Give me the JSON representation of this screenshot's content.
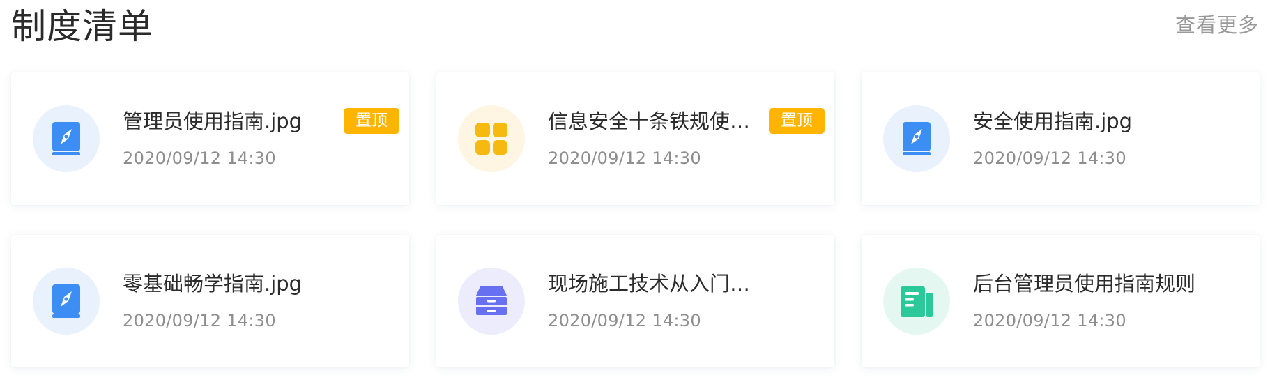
{
  "header": {
    "title": "制度清单",
    "view_more": "查看更多"
  },
  "colors": {
    "pin_badge": "#ffb400",
    "blue_icon": "#3c8ef5",
    "yellow_icon": "#f5b90f",
    "purple_icon": "#6670f0",
    "green_icon": "#2bc89a"
  },
  "cards": [
    {
      "title": "管理员使用指南.jpg",
      "date": "2020/09/12 14:30",
      "pin": "置顶",
      "icon": "book-compass-icon"
    },
    {
      "title": "信息安全十条铁规使用…",
      "date": "2020/09/12 14:30",
      "pin": "置顶",
      "icon": "grid-apps-icon"
    },
    {
      "title": "安全使用指南.jpg",
      "date": "2020/09/12 14:30",
      "icon": "book-compass-icon"
    },
    {
      "title": "零基础畅学指南.jpg",
      "date": "2020/09/12 14:30",
      "icon": "book-compass-icon"
    },
    {
      "title": "现场施工技术从入门到…",
      "date": "2020/09/12 14:30",
      "icon": "drawer-cabinet-icon"
    },
    {
      "title": "后台管理员使用指南规则",
      "date": "2020/09/12 14:30",
      "icon": "document-icon"
    }
  ]
}
